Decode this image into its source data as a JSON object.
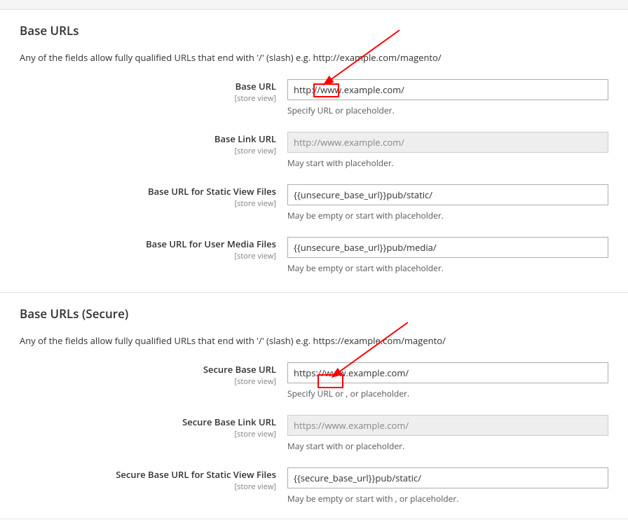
{
  "sections": {
    "baseUrls": {
      "title": "Base URLs",
      "description": "Any of the fields allow fully qualified URLs that end with '/' (slash) e.g. http://example.com/magento/",
      "fields": {
        "baseUrl": {
          "label": "Base URL",
          "scope": "[store view]",
          "value": "http://www.example.com/",
          "hint": "Specify URL or placeholder."
        },
        "baseLinkUrl": {
          "label": "Base Link URL",
          "scope": "[store view]",
          "value": "http://www.example.com/",
          "hint": "May start with placeholder."
        },
        "baseStaticUrl": {
          "label": "Base URL for Static View Files",
          "scope": "[store view]",
          "value": "{{unsecure_base_url}}pub/static/",
          "hint": "May be empty or start with placeholder."
        },
        "baseMediaUrl": {
          "label": "Base URL for User Media Files",
          "scope": "[store view]",
          "value": "{{unsecure_base_url}}pub/media/",
          "hint": "May be empty or start with placeholder."
        }
      }
    },
    "baseUrlsSecure": {
      "title": "Base URLs (Secure)",
      "description": "Any of the fields allow fully qualified URLs that end with '/' (slash) e.g. https://example.com/magento/",
      "fields": {
        "secureBaseUrl": {
          "label": "Secure Base URL",
          "scope": "[store view]",
          "value": "https://www.example.com/",
          "hint": "Specify URL or , or placeholder."
        },
        "secureBaseLinkUrl": {
          "label": "Secure Base Link URL",
          "scope": "[store view]",
          "value": "https://www.example.com/",
          "hint": "May start with or placeholder."
        },
        "secureBaseStaticUrl": {
          "label": "Secure Base URL for Static View Files",
          "scope": "[store view]",
          "value": "{{secure_base_url}}pub/static/",
          "hint": "May be empty or start with , or placeholder."
        }
      }
    }
  },
  "annotations": {
    "highlight1": {
      "text": "www."
    },
    "highlight2": {
      "text": "www."
    }
  }
}
